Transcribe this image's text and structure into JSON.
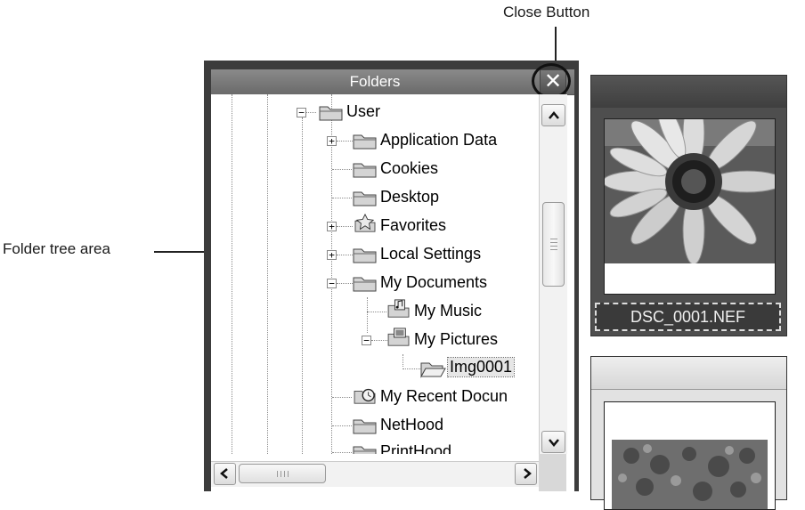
{
  "callouts": {
    "close_button": "Close Button",
    "folder_tree_area": "Folder tree area"
  },
  "panel": {
    "title": "Folders",
    "close_glyph": "✕"
  },
  "tree": {
    "items": [
      {
        "label": "User",
        "icon": "folder-icon",
        "expander": "−"
      },
      {
        "label": "Application Data",
        "icon": "folder-icon",
        "expander": "+"
      },
      {
        "label": "Cookies",
        "icon": "folder-icon"
      },
      {
        "label": "Desktop",
        "icon": "folder-icon"
      },
      {
        "label": "Favorites",
        "icon": "star-folder-icon",
        "expander": "+"
      },
      {
        "label": "Local Settings",
        "icon": "folder-icon",
        "expander": "+"
      },
      {
        "label": "My Documents",
        "icon": "folder-icon",
        "expander": "−"
      },
      {
        "label": "My Music",
        "icon": "music-folder-icon"
      },
      {
        "label": "My Pictures",
        "icon": "pictures-folder-icon",
        "expander": "−"
      },
      {
        "label": "Img0001",
        "icon": "open-folder-icon",
        "selected": true
      },
      {
        "label": "My Recent Docun",
        "icon": "recent-folder-icon"
      },
      {
        "label": "NetHood",
        "icon": "folder-icon"
      },
      {
        "label": "PrintHood",
        "icon": "folder-icon"
      }
    ]
  },
  "thumbnails": {
    "items": [
      {
        "filename": "DSC_0001.NEF",
        "selected": true
      },
      {
        "filename": "",
        "selected": false
      }
    ]
  },
  "colors": {
    "header": "#6a6a6a",
    "frame": "#3c3c3c",
    "selected_card": "#4e4e4e"
  }
}
